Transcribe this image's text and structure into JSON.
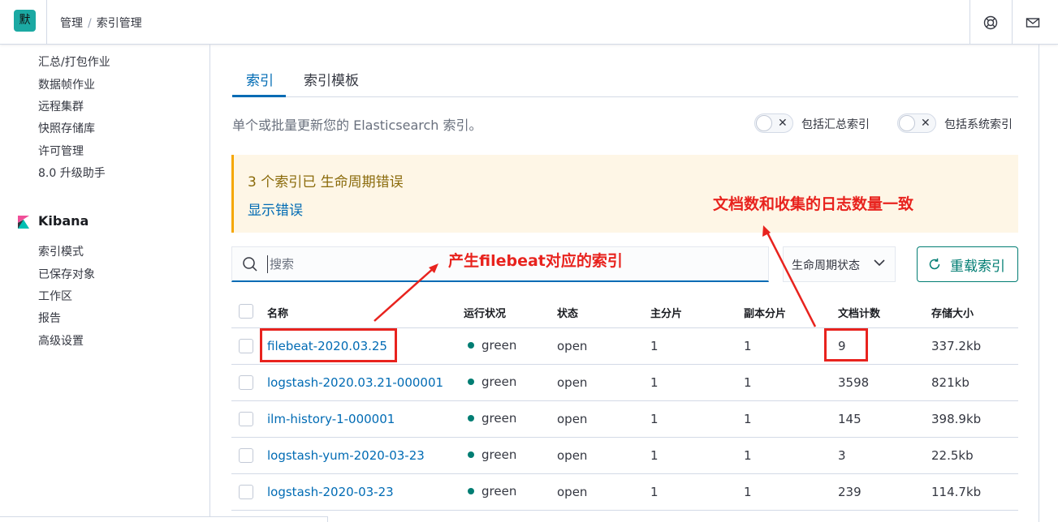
{
  "header": {
    "logo_initial": "默",
    "logo_color": "#1ba9a3",
    "breadcrumb": [
      "管理",
      "索引管理"
    ],
    "icons": [
      "help-icon",
      "mail-icon"
    ]
  },
  "sidebar": {
    "elasticsearch_items": [
      "汇总/打包作业",
      "数据帧作业",
      "远程集群",
      "快照存储库",
      "许可管理",
      "8.0 升级助手"
    ],
    "kibana_title": "Kibana",
    "kibana_items": [
      "索引模式",
      "已保存对象",
      "工作区",
      "报告",
      "高级设置"
    ]
  },
  "tabs": [
    {
      "label": "索引",
      "active": true
    },
    {
      "label": "索引模板",
      "active": false
    }
  ],
  "description": "单个或批量更新您的 Elasticsearch 索引。",
  "toggles": [
    {
      "label": "包括汇总索引",
      "on": false
    },
    {
      "label": "包括系统索引",
      "on": false
    }
  ],
  "callout": {
    "title": "3 个索引已 生命周期错误",
    "link": "显示错误"
  },
  "search": {
    "placeholder": "搜索"
  },
  "lifecycle_filter": "生命周期状态",
  "reload_button": "重载索引",
  "table": {
    "columns": [
      "名称",
      "运行状况",
      "状态",
      "主分片",
      "副本分片",
      "文档计数",
      "存储大小"
    ],
    "rows": [
      {
        "name": "filebeat-2020.03.25",
        "health": "green",
        "status": "open",
        "primary": "1",
        "replica": "1",
        "docs": "9",
        "size": "337.2kb"
      },
      {
        "name": "logstash-2020.03.21-000001",
        "health": "green",
        "status": "open",
        "primary": "1",
        "replica": "1",
        "docs": "3598",
        "size": "821kb"
      },
      {
        "name": "ilm-history-1-000001",
        "health": "green",
        "status": "open",
        "primary": "1",
        "replica": "1",
        "docs": "145",
        "size": "398.9kb"
      },
      {
        "name": "logstash-yum-2020-03-23",
        "health": "green",
        "status": "open",
        "primary": "1",
        "replica": "1",
        "docs": "3",
        "size": "22.5kb"
      },
      {
        "name": "logstash-2020-03-23",
        "health": "green",
        "status": "open",
        "primary": "1",
        "replica": "1",
        "docs": "239",
        "size": "114.7kb"
      }
    ],
    "health_color": "#017d73"
  },
  "annotations": {
    "index_note": "产生filebeat对应的索引",
    "count_note": "文档数和收集的日志数量一致",
    "color": "#e8231e"
  }
}
